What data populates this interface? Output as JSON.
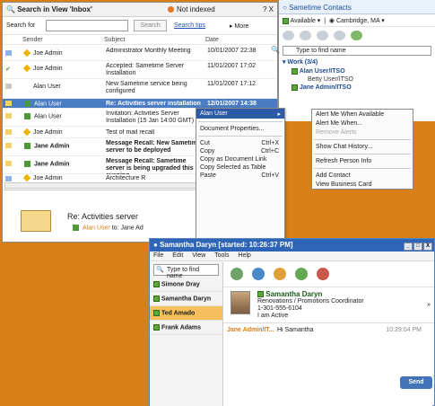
{
  "search": {
    "title": "Search in View 'Inbox'",
    "status": "Not indexed",
    "window_controls": "? X",
    "label": "Search for",
    "input_value": "",
    "button": "Search",
    "tips": "Search tips",
    "more": "More",
    "columns": {
      "sender": "Sender",
      "subject": "Subject",
      "date": "Date"
    },
    "rows": [
      {
        "sender": "Joe Admin",
        "subject": "Administrator Monthly Meeting",
        "date": "10/01/2007 22:38"
      },
      {
        "sender": "Joe Admin",
        "subject": "Accepted: Sametime Server Installation",
        "date": "11/01/2007 17:02"
      },
      {
        "sender": "Alan User",
        "subject": "New Sametime service being configured",
        "date": "11/01/2007 17:12"
      },
      {
        "sender": "Alan User",
        "subject": "Re: Activities server installation",
        "date": "12/01/2007 14:38"
      },
      {
        "sender": "Alan User",
        "subject": "Invitation: Activities Server Installation (15 Jan 14:00 GMT)",
        "date": ""
      },
      {
        "sender": "Joe Admin",
        "subject": "Test of mail recall",
        "date": ""
      },
      {
        "sender": "Jane Admin",
        "subject": "Message Recall: New Sametime server to be deployed",
        "date": ""
      },
      {
        "sender": "Jane Admin",
        "subject": "Message Recall: Sametime server is being upgraded this evening",
        "date": ""
      },
      {
        "sender": "Joe Admin",
        "subject": "Architecture R",
        "date": ""
      }
    ],
    "preview": {
      "subject": "Re: Activities server",
      "from": "Alan User",
      "to_label": "to:",
      "to": "Jane Ad"
    }
  },
  "context_menu": {
    "header": "Alan User",
    "items": [
      {
        "label": "Document Properties...",
        "shortcut": ""
      },
      {
        "label": "Cut",
        "shortcut": "Ctrl+X"
      },
      {
        "label": "Copy",
        "shortcut": "Ctrl+C"
      },
      {
        "label": "Copy as Document Link",
        "shortcut": ""
      },
      {
        "label": "Copy Selected as Table",
        "shortcut": ""
      },
      {
        "label": "Paste",
        "shortcut": "Ctrl+V"
      }
    ]
  },
  "submenu": {
    "items": [
      {
        "label": "Alert Me When Available"
      },
      {
        "label": "Alert Me When..."
      },
      {
        "label": "Remove Alerts"
      },
      {
        "label": "Show Chat History..."
      },
      {
        "label": "Refresh Person Info"
      },
      {
        "label": "Add Contact"
      },
      {
        "label": "View Business Card"
      }
    ]
  },
  "contacts": {
    "title": "Sametime Contacts",
    "status": "Available",
    "location": "Cambridge, MA",
    "find_placeholder": "Type to find name",
    "group": "Work (3/4)",
    "items": [
      "Alan User/ITSO",
      "Betty User/ITSO",
      "Jane Admin/ITSO"
    ]
  },
  "chat": {
    "title": "Samantha Daryn [started: 10:26:37 PM]",
    "menu": [
      "File",
      "Edit",
      "View",
      "Tools",
      "Help"
    ],
    "find_placeholder": "Type to find name",
    "participants": [
      "Simone Dray",
      "Samantha Daryn",
      "Ted Amado",
      "Frank Adams"
    ],
    "profile": {
      "name": "Samantha Daryn",
      "title": "Renovations / Promotions Coordinator",
      "phone": "1-301-555-6104",
      "status": "I am Active"
    },
    "message": {
      "from": "Jane Admin/IT...",
      "text": "Hi Samantha",
      "time": "10:29:04 PM"
    },
    "send": "Send"
  }
}
